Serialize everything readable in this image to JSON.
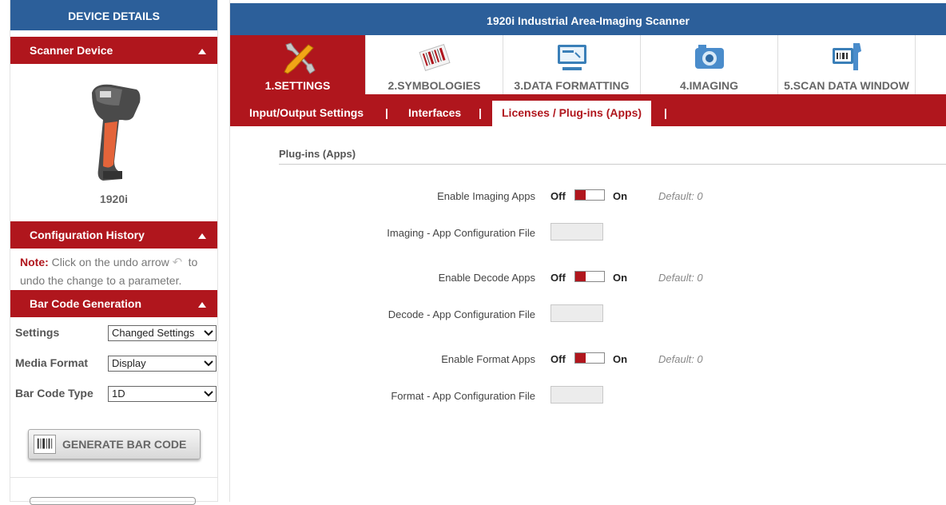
{
  "left_panel": {
    "title": "DEVICE DETAILS",
    "scanner_device": {
      "header": "Scanner Device",
      "device_name": "1920i"
    },
    "config_history": {
      "header": "Configuration History",
      "note_label": "Note:",
      "note_text_1": "Click on the undo arrow",
      "note_text_2": "to",
      "note_text_3": "undo the change to a parameter."
    },
    "barcode_gen": {
      "header": "Bar Code Generation",
      "settings_label": "Settings",
      "settings_value": "Changed Settings",
      "media_label": "Media Format",
      "media_value": "Display",
      "type_label": "Bar Code Type",
      "type_value": "1D",
      "button_label": "GENERATE BAR CODE"
    }
  },
  "right_panel": {
    "title": "1920i Industrial Area-Imaging Scanner",
    "tabs": [
      {
        "label": "1.SETTINGS",
        "icon": "wrench-screwdriver-icon",
        "active": true
      },
      {
        "label": "2.SYMBOLOGIES",
        "icon": "barcode-icon",
        "active": false
      },
      {
        "label": "3.DATA FORMATTING",
        "icon": "monitor-icon",
        "active": false
      },
      {
        "label": "4.IMAGING",
        "icon": "camera-icon",
        "active": false
      },
      {
        "label": "5.SCAN DATA WINDOW",
        "icon": "scanner-monitor-icon",
        "active": false
      }
    ],
    "subtabs": [
      {
        "label": "Input/Output Settings",
        "active": false
      },
      {
        "label": "Interfaces",
        "active": false
      },
      {
        "label": "Licenses / Plug-ins (Apps)",
        "active": true
      }
    ],
    "separator": "|",
    "section_title": "Plug-ins (Apps)",
    "off_label": "Off",
    "on_label": "On",
    "settings": [
      {
        "label": "Enable Imaging Apps",
        "kind": "toggle",
        "value": "Off",
        "default": "Default: 0"
      },
      {
        "label": "Imaging - App Configuration File",
        "kind": "file",
        "value": ""
      },
      {
        "label": "Enable Decode Apps",
        "kind": "toggle",
        "value": "Off",
        "default": "Default: 0"
      },
      {
        "label": "Decode - App Configuration File",
        "kind": "file",
        "value": ""
      },
      {
        "label": "Enable Format Apps",
        "kind": "toggle",
        "value": "Off",
        "default": "Default: 0"
      },
      {
        "label": "Format - App Configuration File",
        "kind": "file",
        "value": ""
      }
    ]
  },
  "colors": {
    "brand_blue": "#2c5f9a",
    "brand_red": "#b0161d"
  }
}
